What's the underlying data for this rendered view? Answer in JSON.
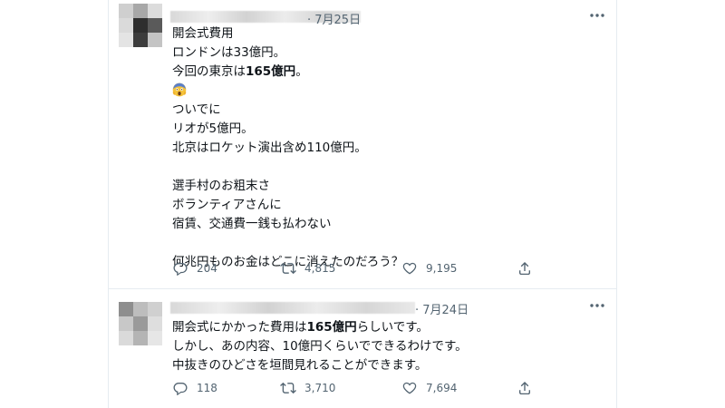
{
  "tweets": [
    {
      "date": "· 7月25日",
      "lines": [
        {
          "parts": [
            {
              "t": "開会式費用"
            }
          ]
        },
        {
          "parts": [
            {
              "t": "ロンドンは33億円。"
            }
          ]
        },
        {
          "parts": [
            {
              "t": "今回の東京は"
            },
            {
              "t": "165億円",
              "b": true
            },
            {
              "t": "。"
            }
          ]
        },
        {
          "emoji": "face-screaming-in-fear"
        },
        {
          "parts": [
            {
              "t": "ついでに"
            }
          ]
        },
        {
          "parts": [
            {
              "t": "リオが5億円。"
            }
          ]
        },
        {
          "parts": [
            {
              "t": "北京はロケット演出含め110億円。"
            }
          ]
        },
        {
          "blank": true
        },
        {
          "parts": [
            {
              "t": "選手村のお粗末さ"
            }
          ]
        },
        {
          "parts": [
            {
              "t": "ボランティアさんに"
            }
          ]
        },
        {
          "parts": [
            {
              "t": "宿賃、交通費一銭も払わない"
            }
          ]
        },
        {
          "blank": true
        },
        {
          "parts": [
            {
              "t": "何兆円ものお金はどこに消えたのだろう？"
            }
          ]
        }
      ],
      "replies": "204",
      "retweets": "4,815",
      "likes": "9,195"
    },
    {
      "date": "· 7月24日",
      "lines": [
        {
          "parts": [
            {
              "t": "開会式にかかった費用は"
            },
            {
              "t": "165億円",
              "b": true
            },
            {
              "t": "らしいです。"
            }
          ]
        },
        {
          "parts": [
            {
              "t": "しかし、あの内容、10億円くらいでできるわけです。"
            }
          ]
        },
        {
          "parts": [
            {
              "t": "中抜きのひどさを垣間見れることができます。"
            }
          ]
        }
      ],
      "replies": "118",
      "retweets": "3,710",
      "likes": "7,694"
    }
  ],
  "icons": {
    "reply": "reply-icon",
    "retweet": "retweet-icon",
    "like": "like-icon",
    "share": "share-icon",
    "more": "more-icon"
  },
  "colors": {
    "text": "#0f1419",
    "muted": "#536471",
    "border": "#e6ecf0"
  }
}
